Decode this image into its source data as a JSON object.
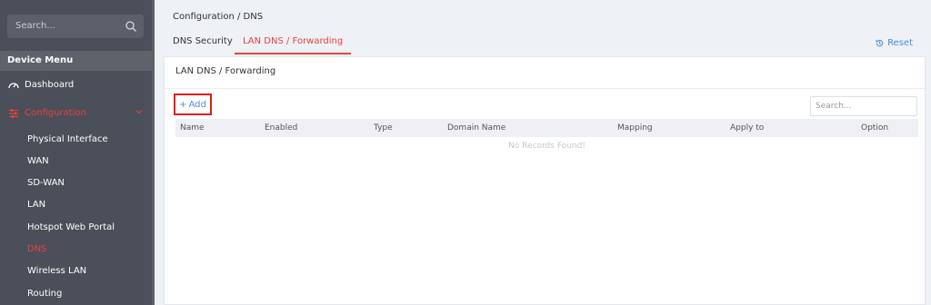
{
  "sidebar": {
    "search_placeholder": "Search...",
    "menu_header": "Device Menu",
    "dashboard": "Dashboard",
    "configuration": "Configuration",
    "sub_items": [
      "Physical Interface",
      "WAN",
      "SD-WAN",
      "LAN",
      "Hotspot Web Portal",
      "DNS",
      "Wireless LAN",
      "Routing"
    ]
  },
  "breadcrumb": "Configuration / DNS",
  "tabs": [
    "DNS Security",
    "LAN DNS / Forwarding"
  ],
  "reset_label": "Reset",
  "panel": {
    "title": "LAN DNS / Forwarding",
    "add_label": "Add",
    "search_placeholder": "Search...",
    "columns": [
      "Name",
      "Enabled",
      "Type",
      "Domain Name",
      "Mapping",
      "Apply to",
      "Option"
    ],
    "empty_text": "No Records Found!"
  },
  "colors": {
    "accent": "#e8413e",
    "link": "#4a8fd8",
    "sidebar": "#4a4f59"
  }
}
